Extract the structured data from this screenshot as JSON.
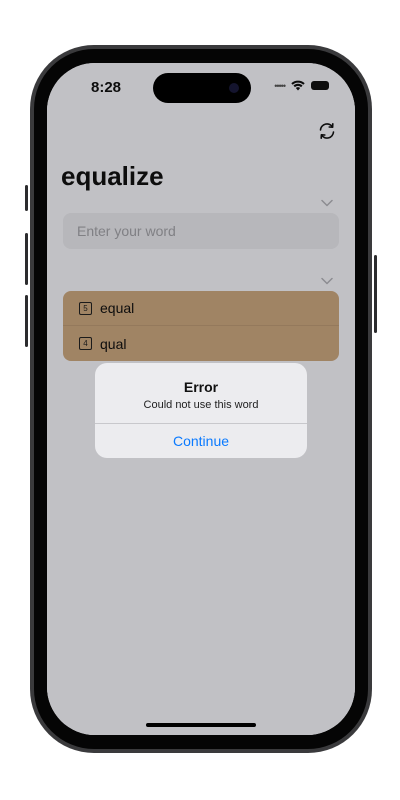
{
  "status_bar": {
    "time": "8:28",
    "signal_icon": "signal-dots-icon",
    "wifi_icon": "wifi-icon",
    "battery_icon": "battery-icon"
  },
  "header": {
    "refresh_icon": "refresh-icon",
    "title": "equalize"
  },
  "input": {
    "placeholder": "Enter your word",
    "value": ""
  },
  "results": {
    "items": [
      {
        "count": "5",
        "word": "equal"
      },
      {
        "count": "4",
        "word": "qual"
      }
    ],
    "row_color": "#c9a57e"
  },
  "alert": {
    "title": "Error",
    "message": "Could not use this word",
    "button": "Continue",
    "button_color": "#0a7aff"
  }
}
